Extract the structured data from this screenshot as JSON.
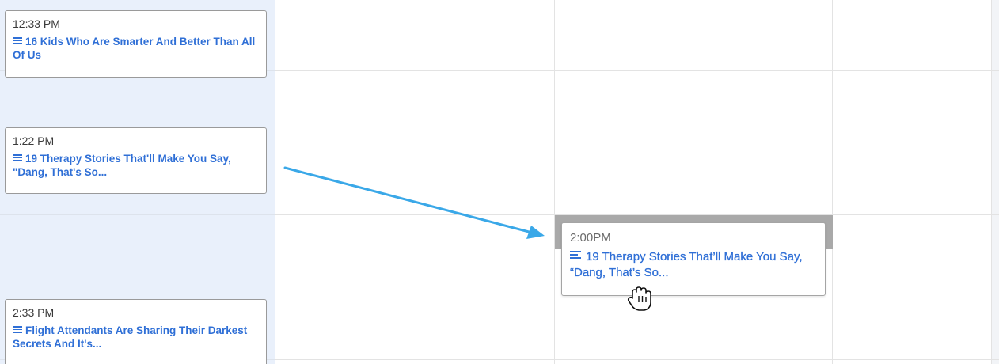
{
  "calendar": {
    "scheduled_posts": [
      {
        "time": "12:33 PM",
        "title": "16 Kids Who Are Smarter And Better Than All Of Us"
      },
      {
        "time": "1:22 PM",
        "title": "19 Therapy Stories That'll Make You Say, \"Dang, That's So..."
      },
      {
        "time": "2:33 PM",
        "title": "Flight Attendants Are Sharing Their Darkest Secrets And It's..."
      }
    ],
    "dragged_post": {
      "time": "2:00PM",
      "title": "19 Therapy Stories That’ll Make You Say, “Dang, That’s So..."
    }
  },
  "colors": {
    "today_column_bg": "#e9f0fb",
    "link_blue": "#2f6fd6",
    "drop_target_gray": "#a9a9a9",
    "arrow_blue": "#3aa8e8"
  },
  "icons": {
    "post_type": "document-lines-icon",
    "cursor": "grab-hand-cursor-icon",
    "annotation": "arrow-icon"
  }
}
